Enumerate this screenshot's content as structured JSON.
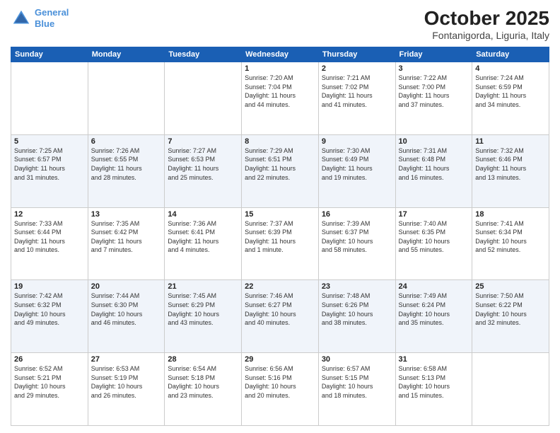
{
  "header": {
    "logo_line1": "General",
    "logo_line2": "Blue",
    "month": "October 2025",
    "location": "Fontanigorda, Liguria, Italy"
  },
  "weekdays": [
    "Sunday",
    "Monday",
    "Tuesday",
    "Wednesday",
    "Thursday",
    "Friday",
    "Saturday"
  ],
  "rows": [
    [
      {
        "day": "",
        "info": ""
      },
      {
        "day": "",
        "info": ""
      },
      {
        "day": "",
        "info": ""
      },
      {
        "day": "1",
        "info": "Sunrise: 7:20 AM\nSunset: 7:04 PM\nDaylight: 11 hours\nand 44 minutes."
      },
      {
        "day": "2",
        "info": "Sunrise: 7:21 AM\nSunset: 7:02 PM\nDaylight: 11 hours\nand 41 minutes."
      },
      {
        "day": "3",
        "info": "Sunrise: 7:22 AM\nSunset: 7:00 PM\nDaylight: 11 hours\nand 37 minutes."
      },
      {
        "day": "4",
        "info": "Sunrise: 7:24 AM\nSunset: 6:59 PM\nDaylight: 11 hours\nand 34 minutes."
      }
    ],
    [
      {
        "day": "5",
        "info": "Sunrise: 7:25 AM\nSunset: 6:57 PM\nDaylight: 11 hours\nand 31 minutes."
      },
      {
        "day": "6",
        "info": "Sunrise: 7:26 AM\nSunset: 6:55 PM\nDaylight: 11 hours\nand 28 minutes."
      },
      {
        "day": "7",
        "info": "Sunrise: 7:27 AM\nSunset: 6:53 PM\nDaylight: 11 hours\nand 25 minutes."
      },
      {
        "day": "8",
        "info": "Sunrise: 7:29 AM\nSunset: 6:51 PM\nDaylight: 11 hours\nand 22 minutes."
      },
      {
        "day": "9",
        "info": "Sunrise: 7:30 AM\nSunset: 6:49 PM\nDaylight: 11 hours\nand 19 minutes."
      },
      {
        "day": "10",
        "info": "Sunrise: 7:31 AM\nSunset: 6:48 PM\nDaylight: 11 hours\nand 16 minutes."
      },
      {
        "day": "11",
        "info": "Sunrise: 7:32 AM\nSunset: 6:46 PM\nDaylight: 11 hours\nand 13 minutes."
      }
    ],
    [
      {
        "day": "12",
        "info": "Sunrise: 7:33 AM\nSunset: 6:44 PM\nDaylight: 11 hours\nand 10 minutes."
      },
      {
        "day": "13",
        "info": "Sunrise: 7:35 AM\nSunset: 6:42 PM\nDaylight: 11 hours\nand 7 minutes."
      },
      {
        "day": "14",
        "info": "Sunrise: 7:36 AM\nSunset: 6:41 PM\nDaylight: 11 hours\nand 4 minutes."
      },
      {
        "day": "15",
        "info": "Sunrise: 7:37 AM\nSunset: 6:39 PM\nDaylight: 11 hours\nand 1 minute."
      },
      {
        "day": "16",
        "info": "Sunrise: 7:39 AM\nSunset: 6:37 PM\nDaylight: 10 hours\nand 58 minutes."
      },
      {
        "day": "17",
        "info": "Sunrise: 7:40 AM\nSunset: 6:35 PM\nDaylight: 10 hours\nand 55 minutes."
      },
      {
        "day": "18",
        "info": "Sunrise: 7:41 AM\nSunset: 6:34 PM\nDaylight: 10 hours\nand 52 minutes."
      }
    ],
    [
      {
        "day": "19",
        "info": "Sunrise: 7:42 AM\nSunset: 6:32 PM\nDaylight: 10 hours\nand 49 minutes."
      },
      {
        "day": "20",
        "info": "Sunrise: 7:44 AM\nSunset: 6:30 PM\nDaylight: 10 hours\nand 46 minutes."
      },
      {
        "day": "21",
        "info": "Sunrise: 7:45 AM\nSunset: 6:29 PM\nDaylight: 10 hours\nand 43 minutes."
      },
      {
        "day": "22",
        "info": "Sunrise: 7:46 AM\nSunset: 6:27 PM\nDaylight: 10 hours\nand 40 minutes."
      },
      {
        "day": "23",
        "info": "Sunrise: 7:48 AM\nSunset: 6:26 PM\nDaylight: 10 hours\nand 38 minutes."
      },
      {
        "day": "24",
        "info": "Sunrise: 7:49 AM\nSunset: 6:24 PM\nDaylight: 10 hours\nand 35 minutes."
      },
      {
        "day": "25",
        "info": "Sunrise: 7:50 AM\nSunset: 6:22 PM\nDaylight: 10 hours\nand 32 minutes."
      }
    ],
    [
      {
        "day": "26",
        "info": "Sunrise: 6:52 AM\nSunset: 5:21 PM\nDaylight: 10 hours\nand 29 minutes."
      },
      {
        "day": "27",
        "info": "Sunrise: 6:53 AM\nSunset: 5:19 PM\nDaylight: 10 hours\nand 26 minutes."
      },
      {
        "day": "28",
        "info": "Sunrise: 6:54 AM\nSunset: 5:18 PM\nDaylight: 10 hours\nand 23 minutes."
      },
      {
        "day": "29",
        "info": "Sunrise: 6:56 AM\nSunset: 5:16 PM\nDaylight: 10 hours\nand 20 minutes."
      },
      {
        "day": "30",
        "info": "Sunrise: 6:57 AM\nSunset: 5:15 PM\nDaylight: 10 hours\nand 18 minutes."
      },
      {
        "day": "31",
        "info": "Sunrise: 6:58 AM\nSunset: 5:13 PM\nDaylight: 10 hours\nand 15 minutes."
      },
      {
        "day": "",
        "info": ""
      }
    ]
  ]
}
